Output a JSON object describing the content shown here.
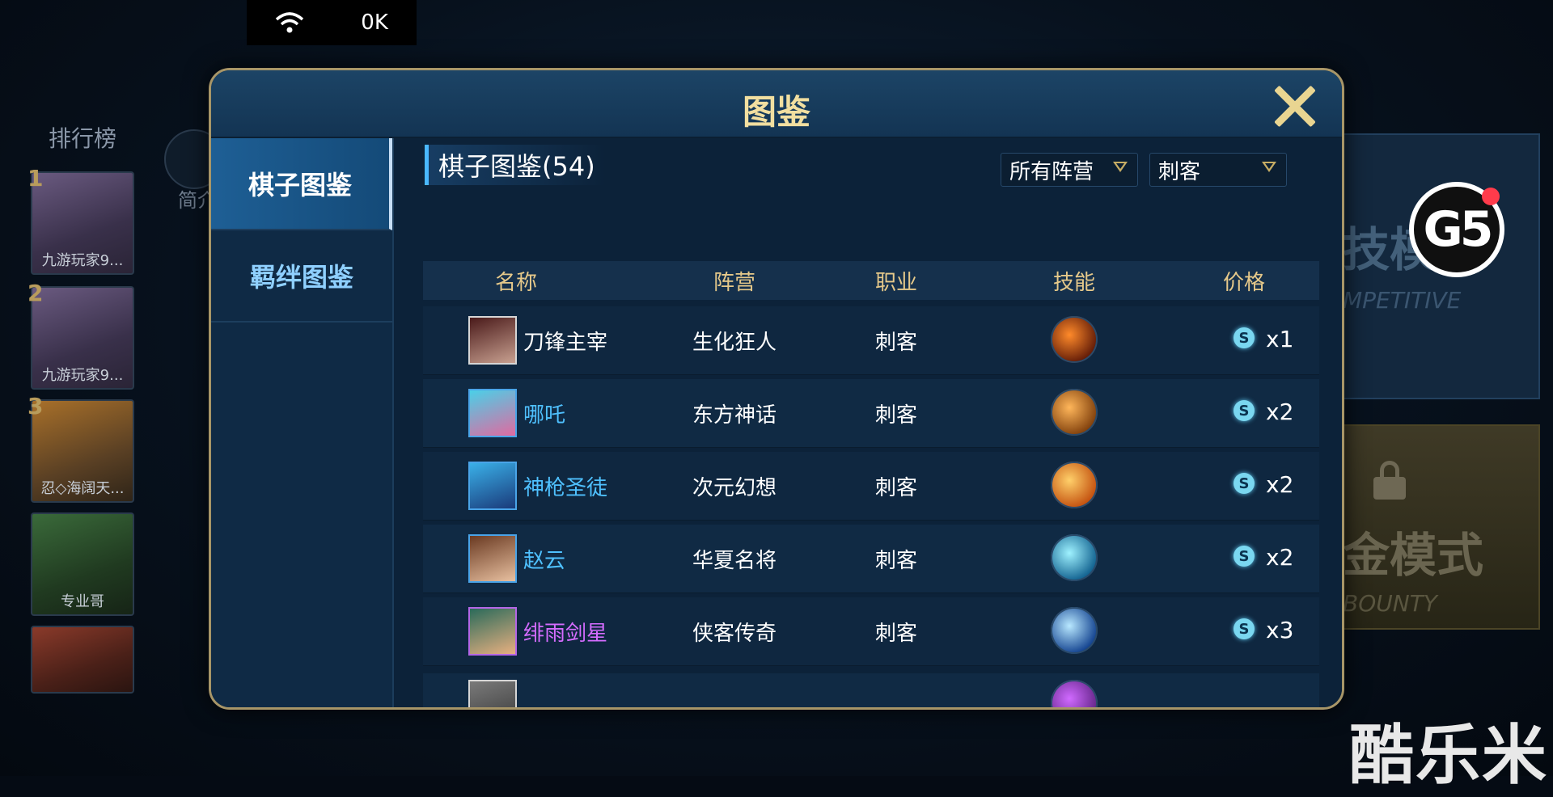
{
  "status_bar": {
    "speed": "0K",
    "wifi_icon": "wifi-icon"
  },
  "background": {
    "leaderboard_title": "排行榜",
    "leaderboard": [
      {
        "rank": "1",
        "name": "九游玩家9..."
      },
      {
        "rank": "2",
        "name": "九游玩家9..."
      },
      {
        "rank": "3",
        "name": "忍◇海阔天..."
      },
      {
        "rank": "",
        "name": "专业哥"
      },
      {
        "rank": "",
        "name": ""
      }
    ],
    "intro_label": "简介",
    "competitive_big": "技模",
    "competitive_sub": "MPETITIVE",
    "bounty_big": "金模式",
    "bounty_sub": "BOUNTY"
  },
  "logo_text": "G5",
  "watermark": "酷乐米",
  "modal": {
    "title": "图鉴",
    "close_icon": "close-icon",
    "tabs": [
      {
        "label": "棋子图鉴",
        "active": true
      },
      {
        "label": "羁绊图鉴",
        "active": false
      }
    ],
    "section_title": "棋子图鉴(54)",
    "filters": {
      "faction": "所有阵营",
      "class": "刺客"
    },
    "columns": [
      "名称",
      "阵营",
      "职业",
      "技能",
      "价格"
    ],
    "rows": [
      {
        "name": "刀锋主宰",
        "name_color": "#ffffff",
        "faction": "生化狂人",
        "class": "刺客",
        "price": "x1",
        "avatar_colors": [
          "#4a1a1a",
          "#c8a090"
        ],
        "skill_colors": [
          "#ff8a2a",
          "#5a1606"
        ]
      },
      {
        "name": "哪吒",
        "name_color": "#4fc1ff",
        "faction": "东方神话",
        "class": "刺客",
        "price": "x2",
        "avatar_colors": [
          "#4ad0e8",
          "#e06aa0"
        ],
        "skill_colors": [
          "#ffb65a",
          "#7a3a08"
        ]
      },
      {
        "name": "神枪圣徒",
        "name_color": "#4fc1ff",
        "faction": "次元幻想",
        "class": "刺客",
        "price": "x2",
        "avatar_colors": [
          "#3ab0e8",
          "#1a3a7a"
        ],
        "skill_colors": [
          "#ffd06a",
          "#c04a0a"
        ]
      },
      {
        "name": "赵云",
        "name_color": "#4fc1ff",
        "faction": "华夏名将",
        "class": "刺客",
        "price": "x2",
        "avatar_colors": [
          "#6a3a22",
          "#e8c0a0"
        ],
        "skill_colors": [
          "#9ff2ff",
          "#0a5a8a"
        ]
      },
      {
        "name": "绯雨剑星",
        "name_color": "#d56cff",
        "faction": "侠客传奇",
        "class": "刺客",
        "price": "x3",
        "avatar_colors": [
          "#2a6a5a",
          "#e8b080"
        ],
        "skill_colors": [
          "#b8e8ff",
          "#0a3a8a"
        ]
      }
    ]
  }
}
